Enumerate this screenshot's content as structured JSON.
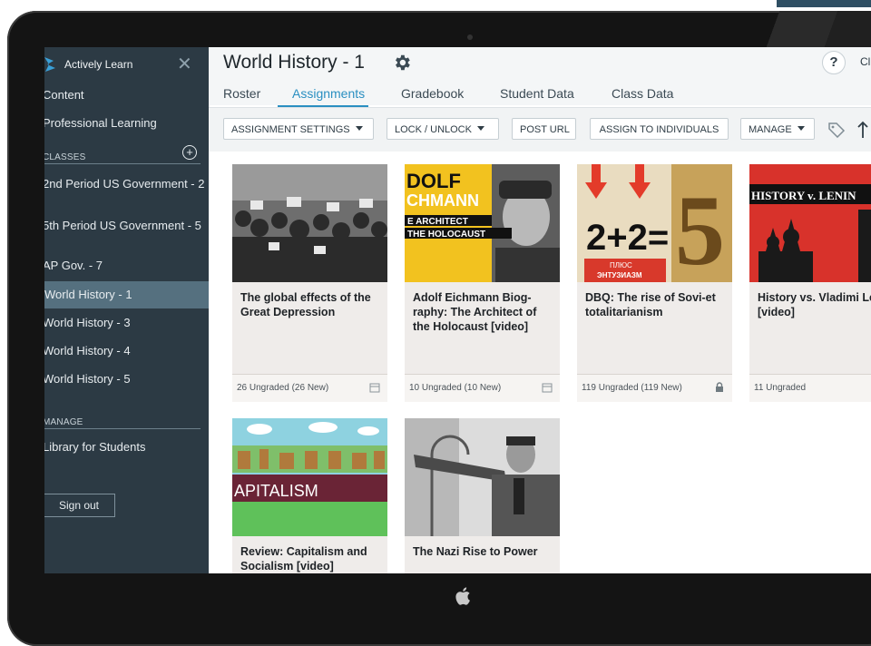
{
  "app": {
    "name": "Actively Learn"
  },
  "colors": {
    "sidebar": "#2c3a44",
    "active_nav": "#55707f",
    "accent": "#2a8fc1"
  },
  "sidebar": {
    "top_items": [
      "Content",
      "Professional Learning"
    ],
    "classes_label": "CLASSES",
    "classes": [
      "2nd Period US Government - 2",
      "5th Period US Government - 5",
      "AP Gov. - 7",
      "World History - 1",
      "World History - 3",
      "World History - 4",
      "World History - 5"
    ],
    "active_class_index": 3,
    "manage_label": "MANAGE",
    "manage_items": [
      "Library for Students"
    ],
    "sign_out": "Sign out"
  },
  "header": {
    "title": "World History - 1",
    "help": "?",
    "user_initial": "Cl",
    "tabs": [
      "Roster",
      "Assignments",
      "Gradebook",
      "Student Data",
      "Class Data"
    ],
    "active_tab": "Assignments"
  },
  "toolbar": {
    "assignment_settings": "ASSIGNMENT SETTINGS",
    "lock_unlock": "LOCK / UNLOCK",
    "post_url": "POST URL",
    "assign_individuals": "ASSIGN TO INDIVIDUALS",
    "manage": "MANAGE"
  },
  "cards": [
    {
      "title": "The global effects of the Great Depression",
      "status": "26 Ungraded (26 New)",
      "icon": "calendar-icon"
    },
    {
      "title": "Adolf Eichmann Biog-raphy: The Architect of the Holocaust [video]",
      "status": "10 Ungraded (10 New)",
      "icon": "calendar-icon",
      "thumb_text": [
        "DOLF",
        "CHMANN",
        "E ARCHITECT",
        "THE HOLOCAUST"
      ]
    },
    {
      "title": "DBQ: The rise of Sovi-et totalitarianism",
      "status": "119 Ungraded (119 New)",
      "icon": "lock-icon",
      "thumb_text": [
        "2+2=",
        "5",
        "ПЛЮС",
        "ЭНТУЗИАЗМ"
      ]
    },
    {
      "title": "History vs. Vladimi Lenin [video]",
      "status": "11 Ungraded",
      "icon": "",
      "thumb_text": [
        "HISTORY v. LENIN"
      ]
    },
    {
      "title": "Review: Capitalism and Socialism [video]",
      "status": "",
      "icon": "",
      "thumb_text": [
        "APITALISM"
      ]
    },
    {
      "title": "The Nazi Rise to Power",
      "status": "",
      "icon": ""
    }
  ]
}
